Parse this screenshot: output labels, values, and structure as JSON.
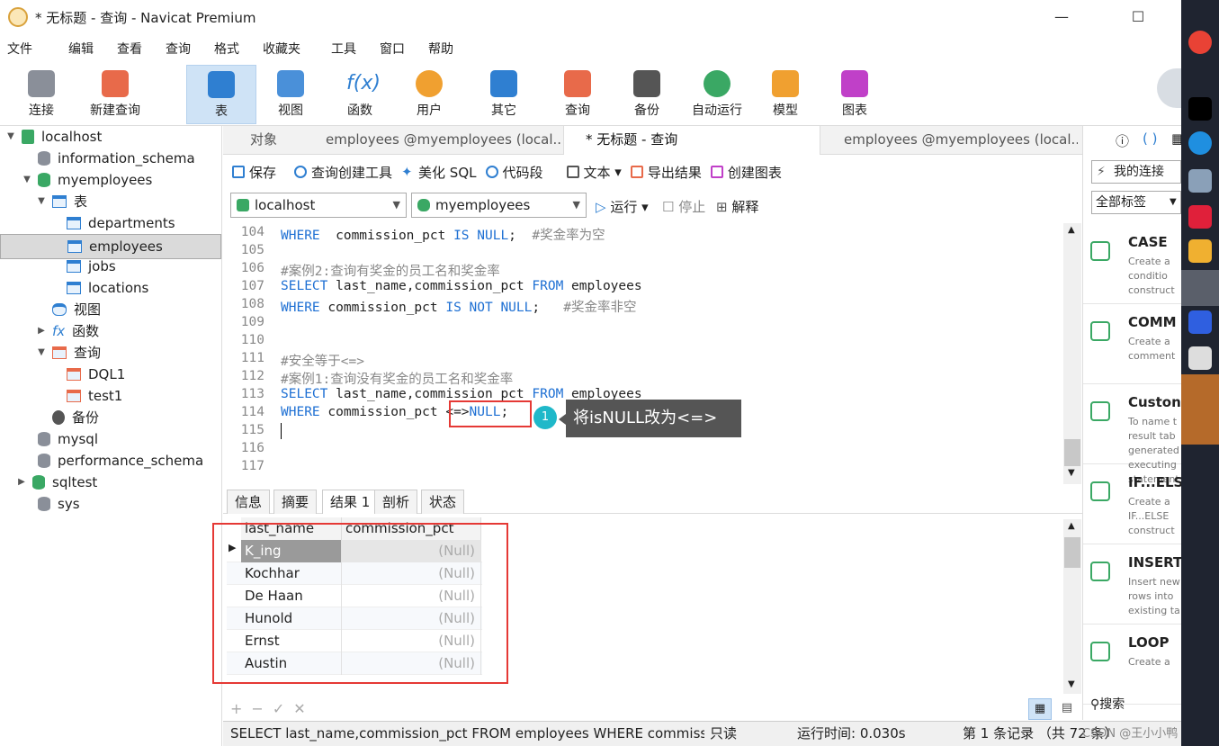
{
  "window": {
    "title": "* 无标题 - 查询 - Navicat Premium",
    "minimize": "—",
    "maximize": "☐"
  },
  "menu": [
    "文件",
    "编辑",
    "查看",
    "查询",
    "格式",
    "收藏夹",
    "工具",
    "窗口",
    "帮助"
  ],
  "toolbar": [
    "连接",
    "新建查询",
    "表",
    "视图",
    "函数",
    "用户",
    "其它",
    "查询",
    "备份",
    "自动运行",
    "模型",
    "图表"
  ],
  "tree": {
    "items": [
      "localhost",
      "information_schema",
      "myemployees",
      "表",
      "departments",
      "employees",
      "jobs",
      "locations",
      "视图",
      "函数",
      "查询",
      "DQL1",
      "test1",
      "备份",
      "mysql",
      "performance_schema",
      "sqltest",
      "sys"
    ]
  },
  "tabs": {
    "objects": "对象",
    "tab1": "employees @myemployees (local...",
    "tab2": "* 无标题 - 查询",
    "tab3": "employees @myemployees (local..."
  },
  "qtool": {
    "save": "保存",
    "builder": "查询创建工具",
    "beautify": "美化 SQL",
    "snippet": "代码段",
    "text": "文本",
    "export": "导出结果",
    "chart": "创建图表"
  },
  "selectors": {
    "connection": "localhost",
    "database": "myemployees",
    "run": "运行",
    "stop": "停止",
    "explain": "解释"
  },
  "editor": {
    "lines": [
      {
        "n": "104",
        "t": [
          [
            "kw",
            "WHERE"
          ],
          [
            "",
            "  commission_pct "
          ],
          [
            "kw",
            "IS NULL"
          ],
          [
            "",
            ";  "
          ],
          [
            "cm",
            "#奖金率为空"
          ]
        ]
      },
      {
        "n": "105",
        "t": []
      },
      {
        "n": "106",
        "t": [
          [
            "cm",
            "#案例2:查询有奖金的员工名和奖金率"
          ]
        ]
      },
      {
        "n": "107",
        "t": [
          [
            "kw",
            "SELECT"
          ],
          [
            "",
            " last_name,commission_pct "
          ],
          [
            "kw",
            "FROM"
          ],
          [
            "",
            " employees"
          ]
        ]
      },
      {
        "n": "108",
        "t": [
          [
            "kw",
            "WHERE"
          ],
          [
            "",
            " commission_pct "
          ],
          [
            "kw",
            "IS NOT NULL"
          ],
          [
            "",
            ";   "
          ],
          [
            "cm",
            "#奖金率非空"
          ]
        ]
      },
      {
        "n": "109",
        "t": []
      },
      {
        "n": "110",
        "t": []
      },
      {
        "n": "111",
        "t": [
          [
            "cm",
            "#安全等于<=>"
          ]
        ]
      },
      {
        "n": "112",
        "t": [
          [
            "cm",
            "#案例1:查询没有奖金的员工名和奖金率"
          ]
        ]
      },
      {
        "n": "113",
        "t": [
          [
            "kw",
            "SELECT"
          ],
          [
            "",
            " last_name,commission_pct "
          ],
          [
            "kw",
            "FROM"
          ],
          [
            "",
            " employees"
          ]
        ]
      },
      {
        "n": "114",
        "t": [
          [
            "kw",
            "WHERE"
          ],
          [
            "",
            " commission_pct "
          ],
          [
            "",
            "<=>"
          ],
          [
            "kw",
            "NULL"
          ],
          [
            "",
            ";"
          ]
        ]
      },
      {
        "n": "115",
        "t": []
      },
      {
        "n": "116",
        "t": []
      },
      {
        "n": "117",
        "t": []
      }
    ],
    "callout_num": "1",
    "callout_text": "将isNULL改为<=>"
  },
  "result_tabs": [
    "信息",
    "摘要",
    "结果 1",
    "剖析",
    "状态"
  ],
  "grid": {
    "headers": [
      "last_name",
      "commission_pct"
    ],
    "rows": [
      [
        "K_ing",
        "(Null)"
      ],
      [
        "Kochhar",
        "(Null)"
      ],
      [
        "De Haan",
        "(Null)"
      ],
      [
        "Hunold",
        "(Null)"
      ],
      [
        "Ernst",
        "(Null)"
      ],
      [
        "Austin",
        "(Null)"
      ]
    ]
  },
  "status": {
    "sql": "SELECT last_name,commission_pct FROM employees WHERE commissio",
    "mode": "只读",
    "time": "运行时间: 0.030s",
    "records": "第 1 条记录 （共 72 条）",
    "watermark": "CSDN @王小小鸭"
  },
  "rpanel": {
    "conn": "我的连接",
    "tags": "全部标签",
    "search": "搜索",
    "snippets": [
      {
        "t": "CASE",
        "d": "Create a\nconditio\nconstruct"
      },
      {
        "t": "COMM",
        "d": "Create a\ncomment"
      },
      {
        "t": "Custon",
        "d": "To name t\nresult tab\ngenerated\nexecuting\nstatement"
      },
      {
        "t": "IF...ELS",
        "d": "Create a\nIF...ELSE\nconstruct"
      },
      {
        "t": "INSERT",
        "d": "Insert new\nrows into\nexisting ta"
      },
      {
        "t": "LOOP",
        "d": "Create a"
      }
    ]
  },
  "colors": {
    "accent": "#2f7fd1",
    "highlight": "#e53935",
    "callout": "#555555",
    "teal": "#1fb8c9"
  }
}
